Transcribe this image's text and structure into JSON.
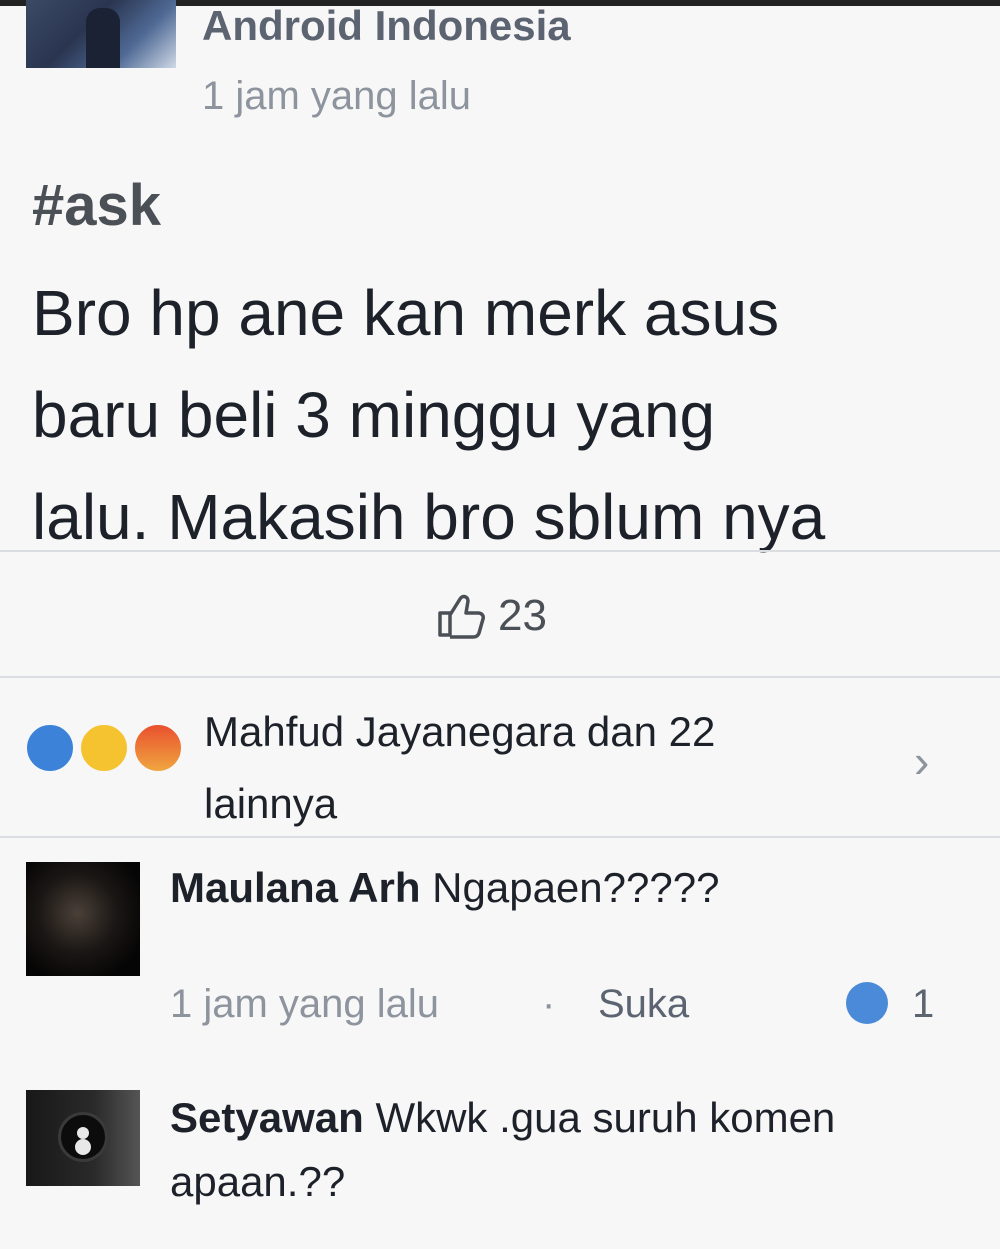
{
  "post": {
    "author": "Android Indonesia",
    "time": "1 jam yang lalu",
    "hashtag": "#ask",
    "body_lines": [
      "Bro hp ane kan merk asus",
      "baru beli 3 minggu yang",
      "lalu. Makasih bro sblum nya"
    ],
    "like_count": "23"
  },
  "reactions": {
    "line1": "Mahfud Jayanegara dan 22",
    "line2": "lainnya"
  },
  "comments": [
    {
      "author": "Maulana Arh",
      "text": "Ngapaen?????",
      "time": "1 jam yang lalu",
      "separator": "·",
      "like_label": "Suka",
      "like_count": "1"
    },
    {
      "author": "Setyawan",
      "text_line1": "Wkwk .gua suruh komen",
      "text_line2": "apaan.??"
    }
  ],
  "colors": {
    "like_blue": "#3b82d8",
    "divider": "#dadde1",
    "muted": "#8d949e"
  },
  "icons": {
    "like": "thumbs-up-outline-icon",
    "chevron": "chevron-right-icon"
  }
}
